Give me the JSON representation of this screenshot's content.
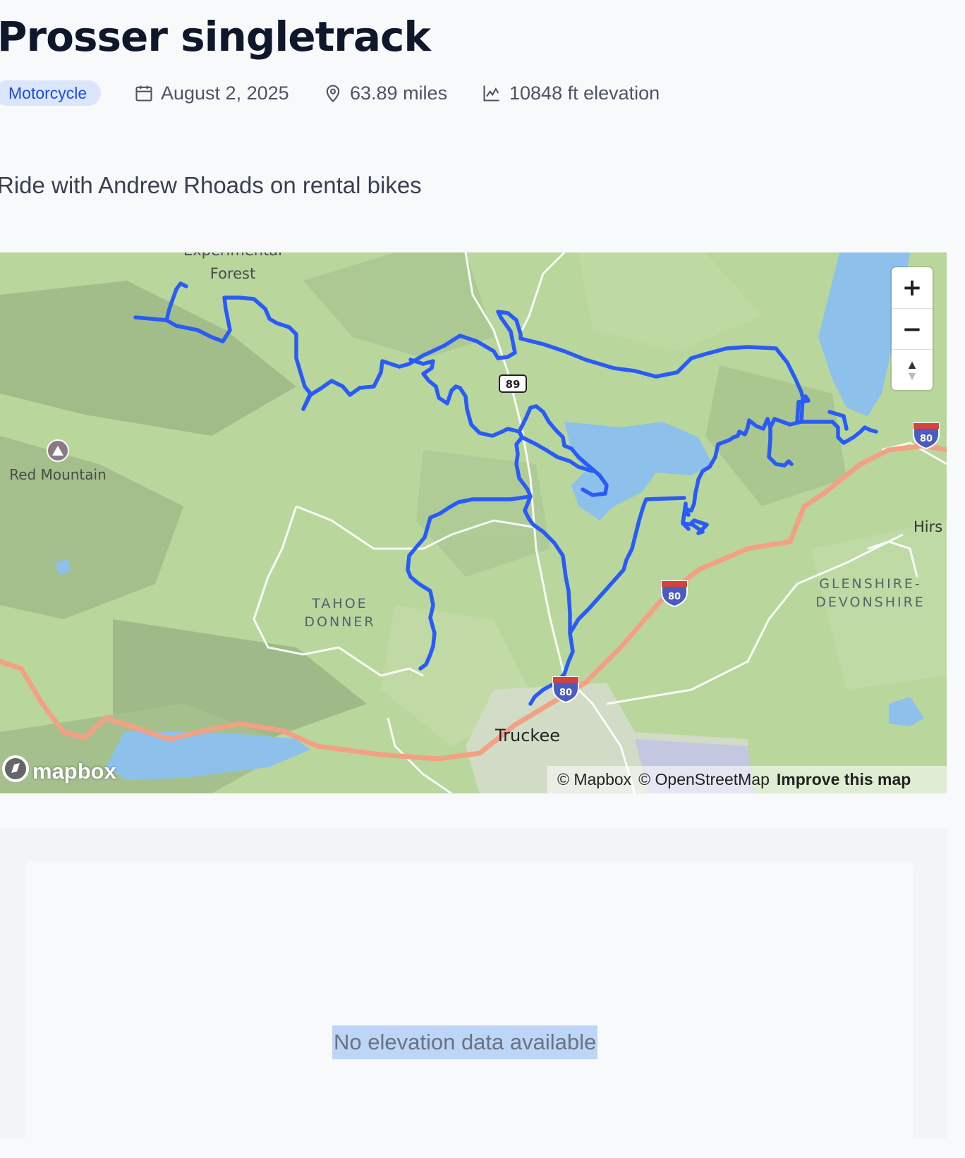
{
  "ride": {
    "title": "Prosser singletrack",
    "type_badge": "Motorcycle",
    "date": "August 2, 2025",
    "distance": "63.89 miles",
    "elevation": "10848 ft elevation",
    "description": "Ride with Andrew Rhoads on rental bikes"
  },
  "map": {
    "labels": {
      "forest_line1": "Experimental",
      "forest_line2": "Forest",
      "red_mountain": "Red Mountain",
      "tahoe_donner_1": "TAHOE",
      "tahoe_donner_2": "DONNER",
      "glenshire_1": "GLENSHIRE-",
      "glenshire_2": "DEVONSHIRE",
      "truckee": "Truckee",
      "hirs": "Hirs",
      "hwy89": "89",
      "i80": "80"
    },
    "controls": {
      "zoom_in": "+",
      "zoom_out": "−",
      "compass": "▲"
    },
    "logo": "mapbox",
    "attribution": {
      "mapbox": "© Mapbox",
      "osm": "© OpenStreetMap",
      "improve": "Improve this map"
    },
    "colors": {
      "route": "#2b5bf5",
      "land": "#b9d79c",
      "water": "#8ec0ec",
      "interstate": "#f2a184"
    }
  },
  "elevation_panel": {
    "message": "No elevation data available"
  },
  "icons": [
    "calendar-icon",
    "location-pin-icon",
    "elevation-chart-icon",
    "mapbox-logo-icon"
  ]
}
